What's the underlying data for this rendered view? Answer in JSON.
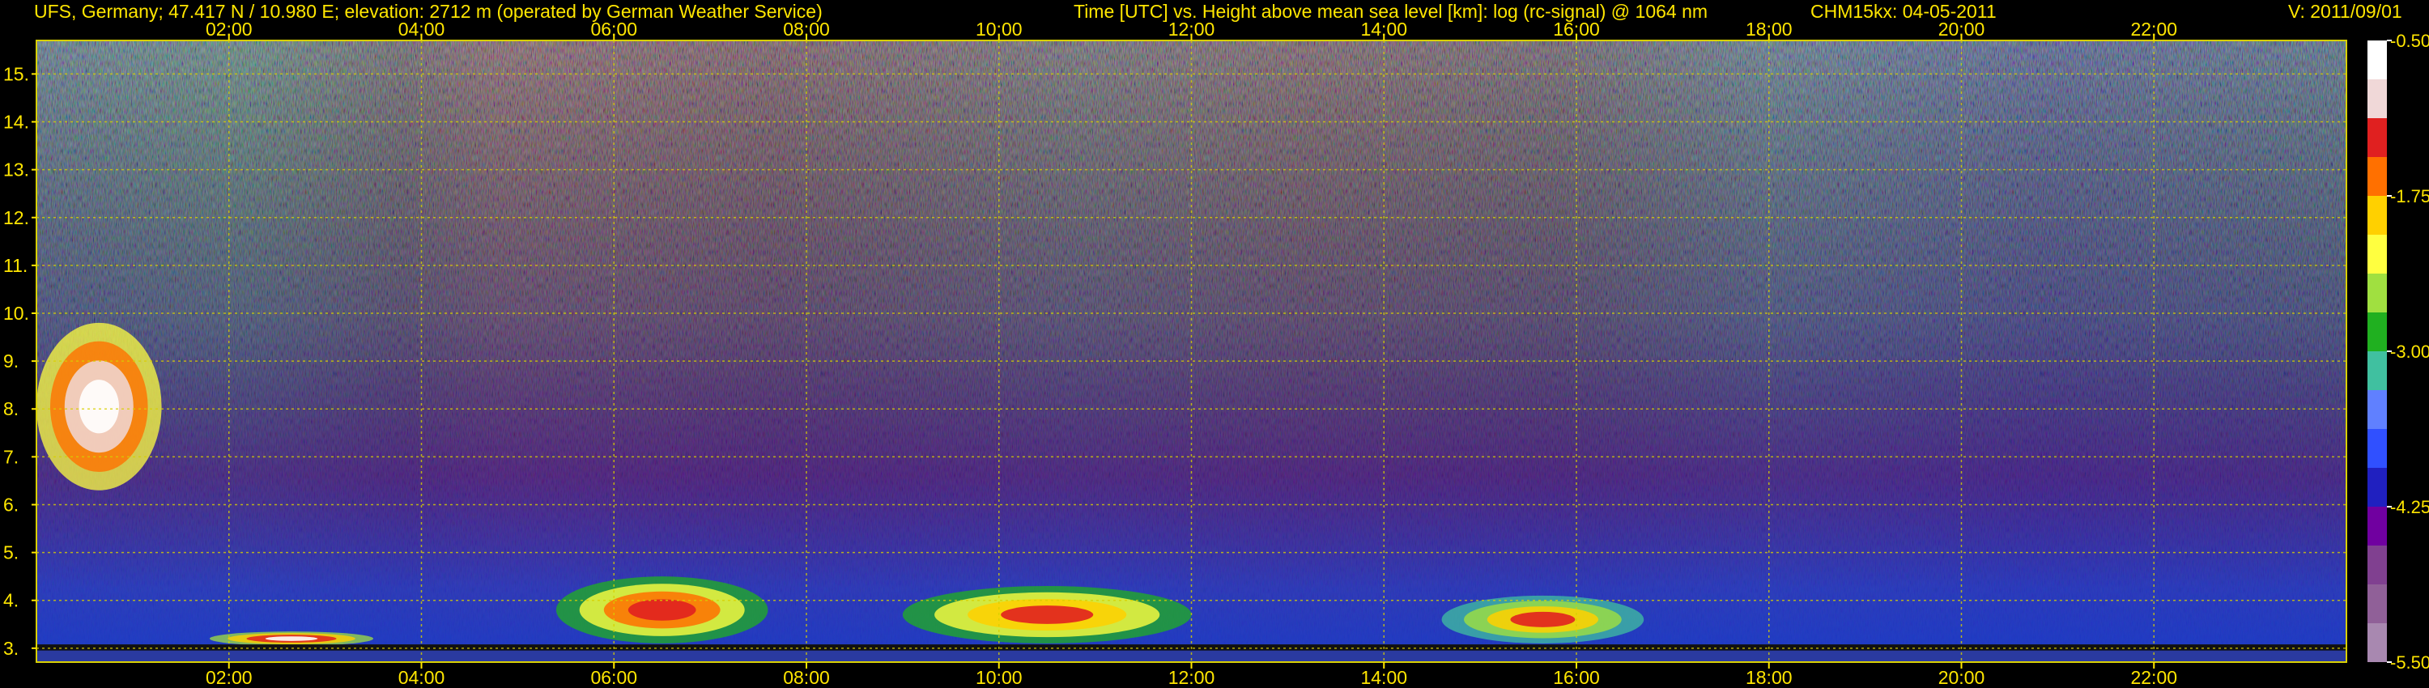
{
  "header": {
    "site": "UFS, Germany; 47.417 N / 10.980 E; elevation: 2712 m  (operated by German Weather Service)",
    "axes": "Time [UTC] vs. Height above mean sea level [km]: log (rc-signal) @ 1064 nm",
    "instrument": "CHM15kx: 04-05-2011",
    "version": "V: 2011/09/01"
  },
  "colors": {
    "background": "#000000",
    "text": "#ffe600",
    "grid": "#d8d000"
  },
  "chart_data": {
    "type": "heatmap",
    "x_unit": "hours UTC",
    "xlim": [
      0,
      24
    ],
    "x_ticks": [
      {
        "value": 2,
        "label": "02:00"
      },
      {
        "value": 4,
        "label": "04:00"
      },
      {
        "value": 6,
        "label": "06:00"
      },
      {
        "value": 8,
        "label": "08:00"
      },
      {
        "value": 10,
        "label": "10:00"
      },
      {
        "value": 12,
        "label": "12:00"
      },
      {
        "value": 14,
        "label": "14:00"
      },
      {
        "value": 16,
        "label": "16:00"
      },
      {
        "value": 18,
        "label": "18:00"
      },
      {
        "value": 20,
        "label": "20:00"
      },
      {
        "value": 22,
        "label": "22:00"
      }
    ],
    "ylim": [
      2.71,
      15.7
    ],
    "y_ticks": [
      {
        "value": 3,
        "label": "3."
      },
      {
        "value": 4,
        "label": "4."
      },
      {
        "value": 5,
        "label": "5."
      },
      {
        "value": 6,
        "label": "6."
      },
      {
        "value": 7,
        "label": "7."
      },
      {
        "value": 8,
        "label": "8."
      },
      {
        "value": 9,
        "label": "9."
      },
      {
        "value": 10,
        "label": "10."
      },
      {
        "value": 11,
        "label": "11."
      },
      {
        "value": 12,
        "label": "12."
      },
      {
        "value": 13,
        "label": "13."
      },
      {
        "value": 14,
        "label": "14."
      },
      {
        "value": 15,
        "label": "15."
      }
    ],
    "grid": true,
    "colorbar": {
      "range": [
        -5.5,
        -0.5
      ],
      "ticks": [
        {
          "value": -0.5,
          "label": "-0.50"
        },
        {
          "value": -1.75,
          "label": "-1.75"
        },
        {
          "value": -3.0,
          "label": "-3.00"
        },
        {
          "value": -4.25,
          "label": "-4.25"
        },
        {
          "value": -5.5,
          "label": "-5.50"
        }
      ],
      "stops": [
        "#ffffff",
        "#f0d8d8",
        "#e02020",
        "#ff7000",
        "#ffd000",
        "#ffff40",
        "#a0e040",
        "#20b020",
        "#40c0a0",
        "#6080ff",
        "#3050ff",
        "#2020c0",
        "#7000a0",
        "#804090",
        "#906098",
        "#a888b0"
      ]
    },
    "features": [
      {
        "name": "upper cloud layer",
        "x": [
          0.0,
          1.3
        ],
        "y": [
          6.3,
          9.8
        ],
        "level": -0.6
      },
      {
        "name": "low cloud band",
        "x": [
          1.8,
          3.5
        ],
        "y": [
          3.05,
          3.35
        ],
        "level": -0.8
      },
      {
        "name": "convective cells morning",
        "x": [
          5.4,
          7.6
        ],
        "y": [
          3.1,
          4.5
        ],
        "level": -1.2
      },
      {
        "name": "convective cells midday",
        "x": [
          9.0,
          12.0
        ],
        "y": [
          3.1,
          4.3
        ],
        "level": -1.3
      },
      {
        "name": "convective cells afternoon",
        "x": [
          14.6,
          16.7
        ],
        "y": [
          3.1,
          4.1
        ],
        "level": -1.4
      }
    ]
  }
}
